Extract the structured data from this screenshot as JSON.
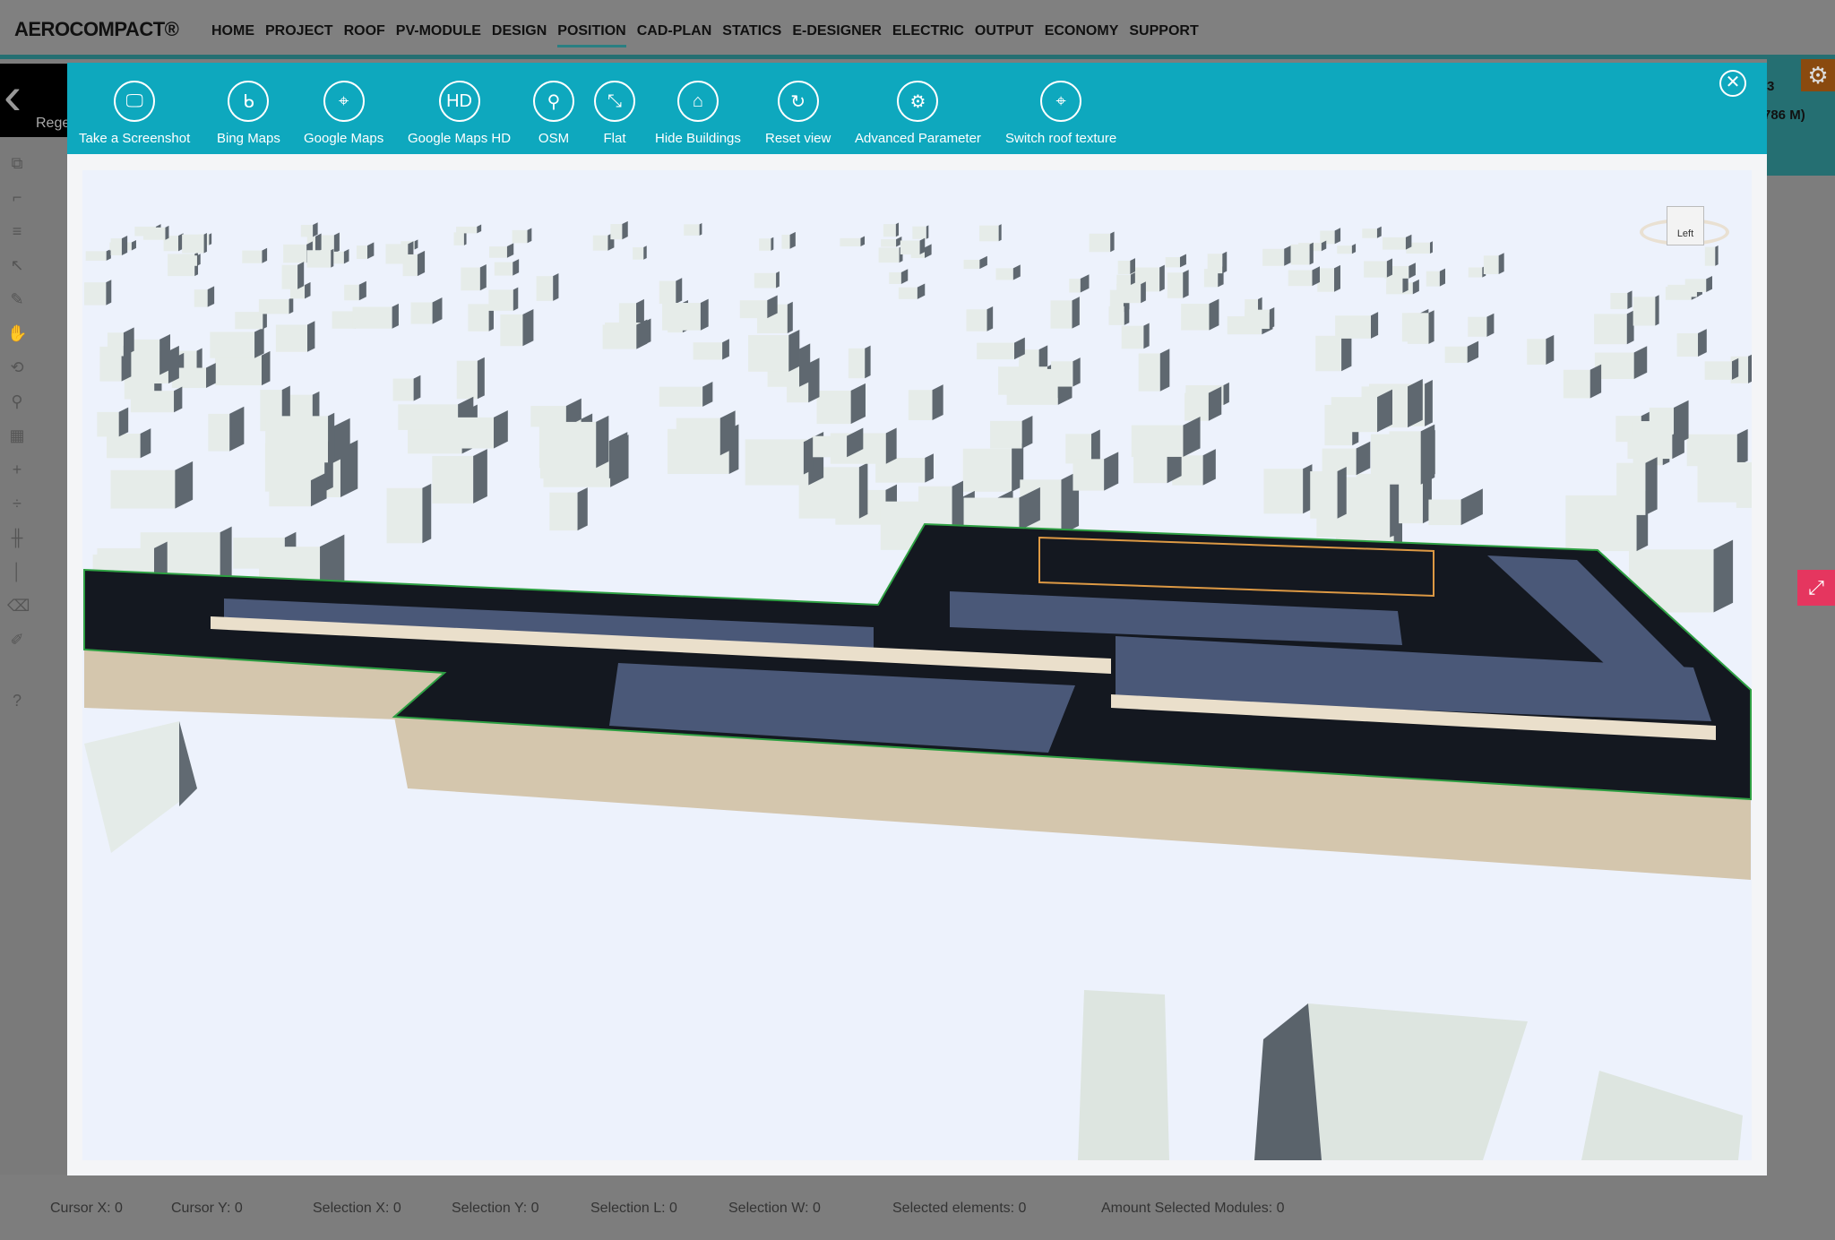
{
  "app": {
    "logo": "AEROCOMPACT®"
  },
  "nav": [
    {
      "label": "HOME"
    },
    {
      "label": "PROJECT"
    },
    {
      "label": "ROOF"
    },
    {
      "label": "PV-MODULE"
    },
    {
      "label": "DESIGN"
    },
    {
      "label": "POSITION",
      "active": true
    },
    {
      "label": "CAD-PLAN"
    },
    {
      "label": "STATICS"
    },
    {
      "label": "E-DESIGNER"
    },
    {
      "label": "ELECTRIC"
    },
    {
      "label": "OUTPUT"
    },
    {
      "label": "ECONOMY"
    },
    {
      "label": "SUPPORT"
    }
  ],
  "left": {
    "label": "Rege"
  },
  "right": {
    "text1": "3",
    "text2": "786 M)"
  },
  "toolbar": [
    {
      "label": "Take a Screenshot",
      "icon": "monitor-icon"
    },
    {
      "label": "Bing Maps",
      "icon": "bing-icon"
    },
    {
      "label": "Google Maps",
      "icon": "map-pin-icon"
    },
    {
      "label": "Google Maps HD",
      "icon": "hd-map-icon"
    },
    {
      "label": "OSM",
      "icon": "osm-icon"
    },
    {
      "label": "Flat",
      "icon": "flat-icon"
    },
    {
      "label": "Hide Buildings",
      "icon": "house-icon"
    },
    {
      "label": "Reset view",
      "icon": "reset-icon"
    },
    {
      "label": "Advanced Parameter",
      "icon": "settings-doc-icon"
    },
    {
      "label": "Switch roof texture",
      "icon": "map-pin-icon"
    }
  ],
  "viewcube": {
    "face": "Left"
  },
  "status": [
    {
      "label": "Cursor X: 0"
    },
    {
      "label": "Cursor Y: 0"
    },
    {
      "label": "Selection X: 0"
    },
    {
      "label": "Selection Y: 0"
    },
    {
      "label": "Selection L: 0"
    },
    {
      "label": "Selection W: 0"
    },
    {
      "label": "Selected elements: 0"
    },
    {
      "label": "Amount Selected Modules: 0"
    }
  ],
  "colors": {
    "accent": "#0ea8be",
    "nav_underline": "#2a7f82",
    "roof": "#141820",
    "slab": "#d4c6ad",
    "panels": "#4a5878"
  }
}
